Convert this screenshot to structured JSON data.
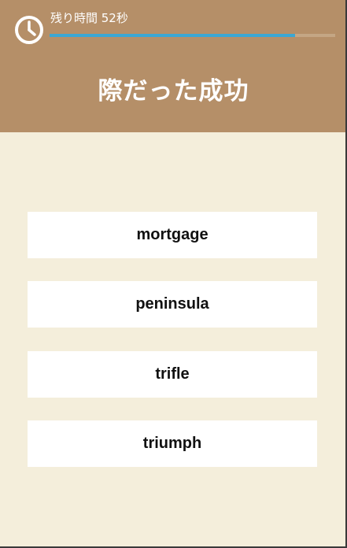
{
  "header": {
    "timer_label": "残り時間 52秒",
    "progress_fraction": 0.86,
    "question": "際だった成功"
  },
  "options": [
    {
      "label": "mortgage"
    },
    {
      "label": "peninsula"
    },
    {
      "label": "trifle"
    },
    {
      "label": "triumph"
    }
  ],
  "colors": {
    "header_bg": "#b58f68",
    "page_bg": "#f4eedb",
    "progress": "#3ba7d3"
  },
  "icons": {
    "timer": "clock-icon"
  }
}
